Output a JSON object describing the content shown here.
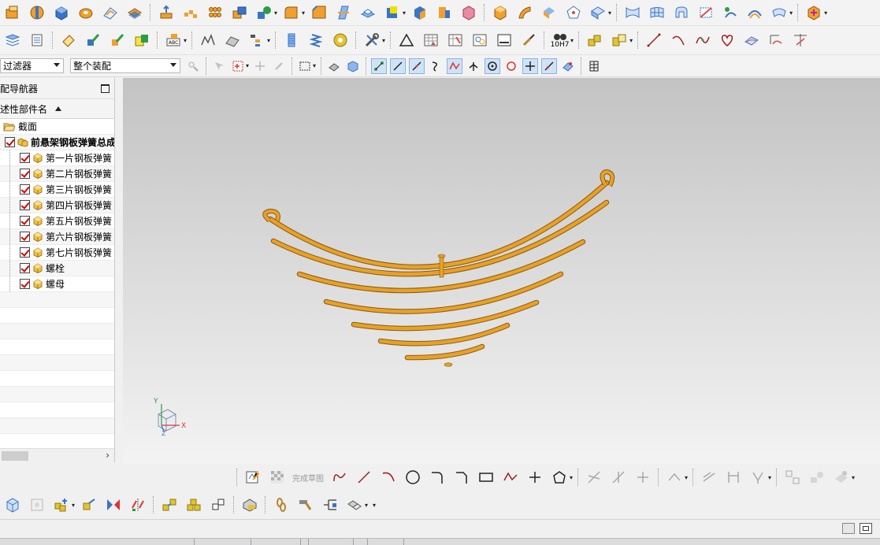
{
  "toolbar3": {
    "filter": "过滤器",
    "assembly_scope": "整个装配"
  },
  "navigator": {
    "title": "配导航器",
    "column_header": "述性部件名",
    "items": [
      {
        "label": "截面",
        "type": "folder"
      },
      {
        "label": "前悬架钢板弹簧总成",
        "type": "assembly"
      },
      {
        "label": "第一片钢板弹簧",
        "type": "part"
      },
      {
        "label": "第二片钢板弹簧",
        "type": "part"
      },
      {
        "label": "第三片钢板弹簧",
        "type": "part"
      },
      {
        "label": "第四片钢板弹簧",
        "type": "part"
      },
      {
        "label": "第五片钢板弹簧",
        "type": "part"
      },
      {
        "label": "第六片钢板弹簧",
        "type": "part"
      },
      {
        "label": "第七片钢板弹簧",
        "type": "part"
      },
      {
        "label": "螺栓",
        "type": "part"
      },
      {
        "label": "螺母",
        "type": "part"
      }
    ],
    "scroll_right": "›"
  },
  "graphics": {
    "axis_x": "X",
    "axis_y": "Y",
    "axis_z": "Z"
  },
  "sketch_toolbar": {
    "finish_sketch": "完成草图"
  },
  "toolbar2": {
    "fit_label": "10H7"
  },
  "colors": {
    "spring_orange": "#e8a127",
    "spring_dark": "#8a5a0f",
    "icon_orange": "#f0a030",
    "icon_blue": "#3a74c5",
    "check_red": "#d10000"
  }
}
